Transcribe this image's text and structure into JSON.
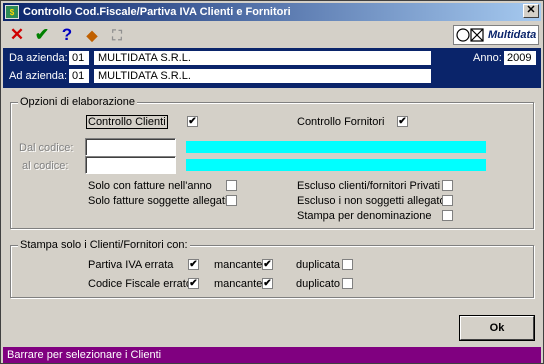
{
  "window": {
    "title": "Controllo Cod.Fiscale/Partiva IVA Clienti e Fornitori",
    "close_glyph": "✕"
  },
  "toolbar": {
    "cancel_icon": "✕",
    "confirm_icon": "✔",
    "help_icon": "?",
    "tool_icon": "◆",
    "binoculars_icon": "⛶",
    "brand_text": "Multidata"
  },
  "header": {
    "from_label": "Da azienda:",
    "from_code": "01",
    "from_name": "MULTIDATA S.R.L.",
    "to_label": "Ad azienda:",
    "to_code": "01",
    "to_name": "MULTIDATA S.R.L.",
    "year_label": "Anno:",
    "year_value": "2009"
  },
  "options": {
    "legend": "Opzioni di elaborazione",
    "controllo_clienti": {
      "label": "Controllo Clienti",
      "checked": true
    },
    "controllo_fornitori": {
      "label": "Controllo Fornitori",
      "checked": true
    },
    "dal_codice_label": "Dal codice:",
    "al_codice_label": "al codice:",
    "dal_codice_value": "",
    "al_codice_value": "",
    "left_checks": [
      {
        "label": "Solo con fatture nell'anno",
        "checked": false
      },
      {
        "label": "Solo fatture soggette allegati",
        "checked": false
      }
    ],
    "right_checks": [
      {
        "label": "Escluso clienti/fornitori Privati",
        "checked": false
      },
      {
        "label": "Escluso i non soggetti allegato",
        "checked": false
      },
      {
        "label": "Stampa per denominazione",
        "checked": false
      }
    ]
  },
  "print_only": {
    "legend": "Stampa solo i Clienti/Fornitori con:",
    "rows": [
      {
        "label": "Partiva IVA errata",
        "errata": true,
        "mancante_label": "mancante",
        "mancante": true,
        "duplicata_label": "duplicata",
        "duplicata": false
      },
      {
        "label": "Codice Fiscale errato",
        "errata": true,
        "mancante_label": "mancante",
        "mancante": true,
        "duplicata_label": "duplicato",
        "duplicata": false
      }
    ]
  },
  "buttons": {
    "ok_label": "Ok"
  },
  "status": {
    "text": "Barrare per selezionare i Clienti"
  },
  "colors": {
    "window_bg": "#d4d0c8",
    "header_band": "#0a246a",
    "cyan_field": "#00ffff",
    "statusbar": "#800080"
  },
  "check_glyph": "✔"
}
